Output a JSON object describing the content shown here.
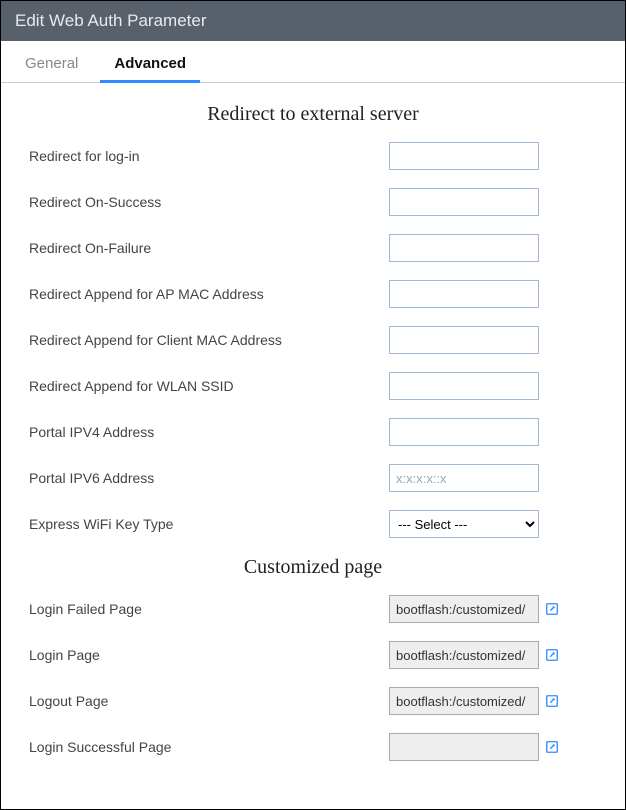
{
  "header": {
    "title": "Edit Web Auth Parameter"
  },
  "tabs": {
    "general": "General",
    "advanced": "Advanced"
  },
  "section1": {
    "title": "Redirect to external server",
    "redirect_login_label": "Redirect for log-in",
    "redirect_login_value": "",
    "redirect_success_label": "Redirect On-Success",
    "redirect_success_value": "",
    "redirect_failure_label": "Redirect On-Failure",
    "redirect_failure_value": "",
    "redirect_ap_mac_label": "Redirect Append for AP MAC Address",
    "redirect_ap_mac_value": "",
    "redirect_client_mac_label": "Redirect Append for Client MAC Address",
    "redirect_client_mac_value": "",
    "redirect_ssid_label": "Redirect Append for WLAN SSID",
    "redirect_ssid_value": "",
    "portal_ipv4_label": "Portal IPV4 Address",
    "portal_ipv4_value": "",
    "portal_ipv6_label": "Portal IPV6 Address",
    "portal_ipv6_value": "",
    "portal_ipv6_placeholder": "x:x:x:x::x",
    "wifi_key_label": "Express WiFi Key Type",
    "wifi_key_value": "--- Select ---"
  },
  "section2": {
    "title": "Customized page",
    "login_failed_label": "Login Failed Page",
    "login_failed_value": "bootflash:/customized/",
    "login_label": "Login Page",
    "login_value": "bootflash:/customized/",
    "logout_label": "Logout Page",
    "logout_value": "bootflash:/customized/",
    "login_success_label": "Login Successful Page",
    "login_success_value": ""
  }
}
